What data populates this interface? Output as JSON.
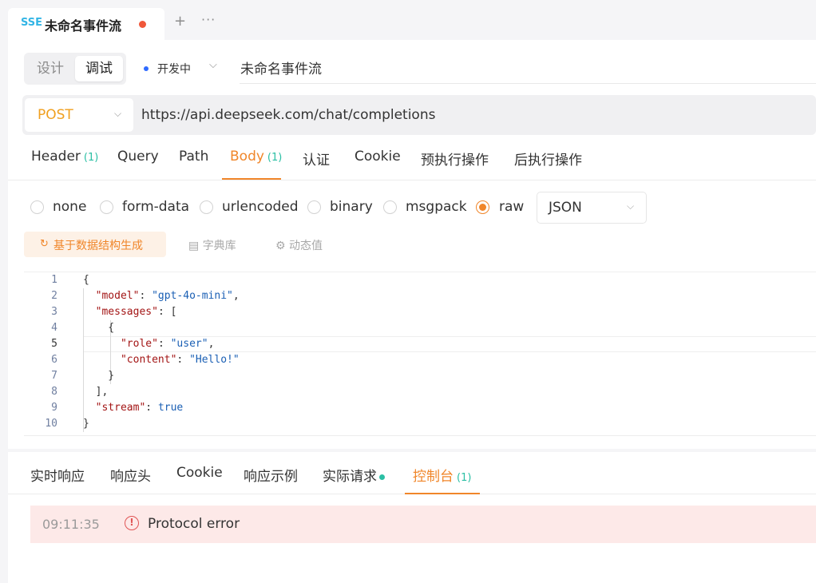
{
  "doc_tab": {
    "badge": "SSE",
    "title": "未命名事件流",
    "add_symbol": "+",
    "more_symbol": "···"
  },
  "mode": {
    "design": "设计",
    "debug": "调试"
  },
  "status": {
    "label": "开发中",
    "chevron": "⌵"
  },
  "api_name": "未命名事件流",
  "request": {
    "method": "POST",
    "url": "https://api.deepseek.com/chat/completions"
  },
  "request_tabs": [
    {
      "label": "Header",
      "count": "(1)"
    },
    {
      "label": "Query",
      "count": ""
    },
    {
      "label": "Path",
      "count": ""
    },
    {
      "label": "Body",
      "count": "(1)"
    },
    {
      "label": "认证",
      "count": ""
    },
    {
      "label": "Cookie",
      "count": ""
    },
    {
      "label": "预执行操作",
      "count": ""
    },
    {
      "label": "后执行操作",
      "count": ""
    }
  ],
  "body_types": [
    "none",
    "form-data",
    "urlencoded",
    "binary",
    "msgpack",
    "raw"
  ],
  "body_selected": "raw",
  "body_format": "JSON",
  "tools": {
    "generate": "基于数据结构生成",
    "dictionary": "字典库",
    "dynamic": "动态值"
  },
  "editor_lines": [
    [
      {
        "t": "{",
        "c": ""
      }
    ],
    [
      {
        "t": "  ",
        "c": ""
      },
      {
        "t": "\"model\"",
        "c": "key"
      },
      {
        "t": ": ",
        "c": ""
      },
      {
        "t": "\"gpt-4o-mini\"",
        "c": "str"
      },
      {
        "t": ",",
        "c": ""
      }
    ],
    [
      {
        "t": "  ",
        "c": ""
      },
      {
        "t": "\"messages\"",
        "c": "key"
      },
      {
        "t": ": [",
        "c": ""
      }
    ],
    [
      {
        "t": "    {",
        "c": ""
      }
    ],
    [
      {
        "t": "      ",
        "c": ""
      },
      {
        "t": "\"role\"",
        "c": "key"
      },
      {
        "t": ": ",
        "c": ""
      },
      {
        "t": "\"user\"",
        "c": "str"
      },
      {
        "t": ",",
        "c": ""
      }
    ],
    [
      {
        "t": "      ",
        "c": ""
      },
      {
        "t": "\"content\"",
        "c": "key"
      },
      {
        "t": ": ",
        "c": ""
      },
      {
        "t": "\"Hello!\"",
        "c": "str"
      }
    ],
    [
      {
        "t": "    }",
        "c": ""
      }
    ],
    [
      {
        "t": "  ],",
        "c": ""
      }
    ],
    [
      {
        "t": "  ",
        "c": ""
      },
      {
        "t": "\"stream\"",
        "c": "key"
      },
      {
        "t": ": ",
        "c": ""
      },
      {
        "t": "true",
        "c": "lit"
      }
    ],
    [
      {
        "t": "}",
        "c": ""
      }
    ]
  ],
  "response_tabs": [
    {
      "label": "实时响应",
      "count": ""
    },
    {
      "label": "响应头",
      "count": ""
    },
    {
      "label": "Cookie",
      "count": ""
    },
    {
      "label": "响应示例",
      "count": ""
    },
    {
      "label": "实际请求",
      "count": ""
    },
    {
      "label": "控制台",
      "count": "(1)"
    }
  ],
  "console": {
    "time": "09:11:35",
    "message": "Protocol error"
  },
  "colors": {
    "accent": "#f0862a",
    "method": "#f0a020",
    "count": "#2bbfa4",
    "error": "#e05555",
    "error_bg": "#fde9e8",
    "status_dot": "#2f6bff"
  }
}
